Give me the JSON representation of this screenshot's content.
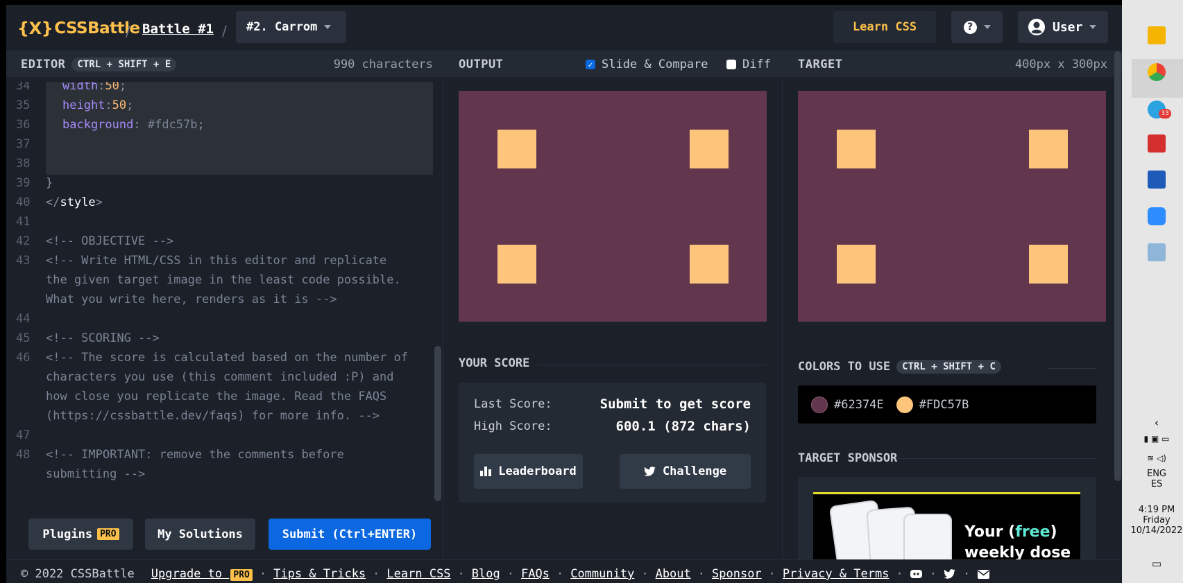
{
  "header": {
    "logo_mark": "{X}",
    "logo_text": "CSSBattle",
    "sep1": "/",
    "battle": "Battle #1",
    "sep2": "/",
    "target_name": "#2. Carrom",
    "learn_css": "Learn CSS",
    "user": "User"
  },
  "editor": {
    "title": "EDITOR",
    "shortcut": "CTRL + SHIFT + E",
    "char_count": "990 characters",
    "lines": [
      {
        "n": "34",
        "text": "width:50;"
      },
      {
        "n": "35",
        "text": "height:50;"
      },
      {
        "n": "36",
        "text": "background: #fdc57b;"
      },
      {
        "n": "37",
        "text": ""
      },
      {
        "n": "38",
        "text": ""
      },
      {
        "n": "39",
        "text": "}"
      },
      {
        "n": "40",
        "text": "</style>"
      },
      {
        "n": "41",
        "text": ""
      },
      {
        "n": "42",
        "text": "<!-- OBJECTIVE -->"
      },
      {
        "n": "43",
        "text": "<!-- Write HTML/CSS in this editor and replicate"
      },
      {
        "n": "",
        "text": "the given target image in the least code possible."
      },
      {
        "n": "",
        "text": "What you write here, renders as it is -->"
      },
      {
        "n": "44",
        "text": ""
      },
      {
        "n": "45",
        "text": "<!-- SCORING -->"
      },
      {
        "n": "46",
        "text": "<!-- The score is calculated based on the number of"
      },
      {
        "n": "",
        "text": "characters you use (this comment included :P) and"
      },
      {
        "n": "",
        "text": "how close you replicate the image. Read the FAQS"
      },
      {
        "n": "",
        "text": "(https://cssbattle.dev/faqs) for more info. -->"
      },
      {
        "n": "47",
        "text": ""
      },
      {
        "n": "48",
        "text": "<!-- IMPORTANT: remove the comments before"
      },
      {
        "n": "",
        "text": "submitting -->"
      }
    ],
    "plugins": "Plugins",
    "pro": "PRO",
    "my_solutions": "My Solutions",
    "submit": "Submit (Ctrl+ENTER)"
  },
  "output": {
    "title": "OUTPUT",
    "slide_compare": "Slide & Compare",
    "diff": "Diff",
    "your_score": "YOUR SCORE",
    "last_score_label": "Last Score:",
    "last_score_value": "Submit to get score",
    "high_score_label": "High Score:",
    "high_score_value": "600.1 (872 chars)",
    "leaderboard": "Leaderboard",
    "challenge": "Challenge"
  },
  "target": {
    "title": "TARGET",
    "dims": "400px x 300px",
    "colors_label": "COLORS TO USE",
    "colors_shortcut": "CTRL + SHIFT + C",
    "colors": [
      {
        "hex": "#62374E",
        "value": "#62374e"
      },
      {
        "hex": "#FDC57B",
        "value": "#fdc57b"
      }
    ],
    "sponsor_label": "TARGET SPONSOR",
    "ad_line1_pre": "Your (",
    "ad_line1_free": "free",
    "ad_line1_post": ")",
    "ad_line2": "weekly dose"
  },
  "footer": {
    "copyright": "© 2022 CSSBattle",
    "upgrade": "Upgrade to",
    "pro": "PRO",
    "links": [
      "Tips & Tricks",
      "Learn CSS",
      "Blog",
      "FAQs",
      "Community",
      "About",
      "Sponsor",
      "Privacy & Terms"
    ],
    "sep": "·"
  },
  "taskbar": {
    "telegram_badge": "33",
    "lang1": "ENG",
    "lang2": "ES",
    "time": "4:19 PM",
    "day": "Friday",
    "date": "10/14/2022"
  }
}
